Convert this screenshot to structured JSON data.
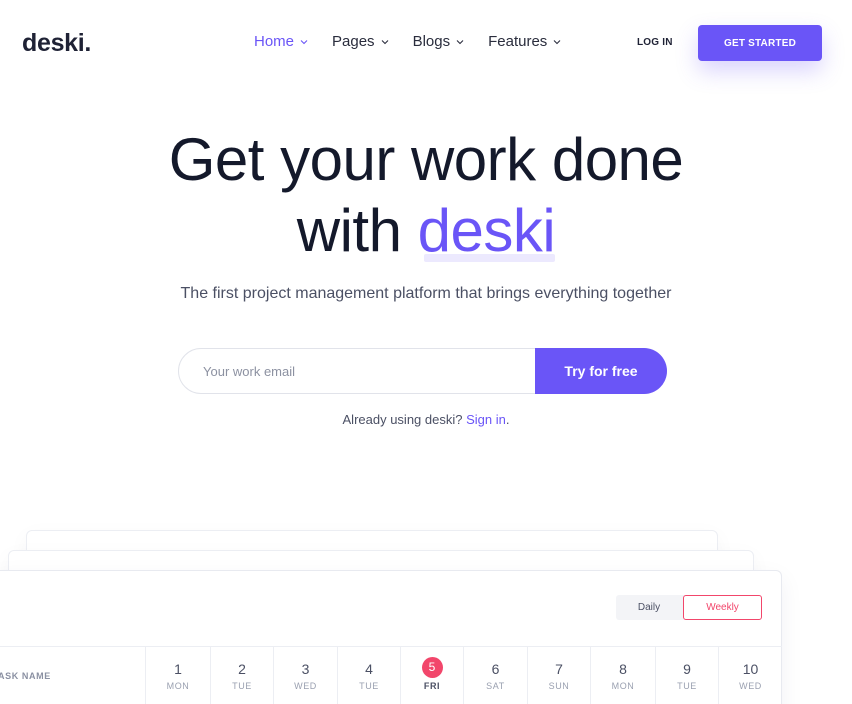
{
  "header": {
    "logo": "deski.",
    "nav": [
      {
        "label": "Home",
        "active": true,
        "icon": "chevron-down-icon"
      },
      {
        "label": "Pages",
        "active": false,
        "icon": "chevron-down-icon"
      },
      {
        "label": "Blogs",
        "active": false,
        "icon": "chevron-down-icon"
      },
      {
        "label": "Features",
        "active": false,
        "icon": "chevron-down-icon"
      }
    ],
    "login": "LOG IN",
    "cta": "GET STARTED"
  },
  "hero": {
    "title_line1": "Get your work done",
    "title_line2_prefix": "with",
    "title_accent": "deski",
    "subtitle": "The first project management platform that brings everything together",
    "email_placeholder": "Your work email",
    "email_value": "",
    "cta": "Try for free",
    "already_text": "Already using deski?",
    "sign_in": "Sign in",
    "period": "."
  },
  "schedule": {
    "toggle": {
      "daily": "Daily",
      "weekly": "Weekly",
      "selected": "Weekly"
    },
    "task_header": "ASK NAME",
    "days": [
      {
        "num": "1",
        "name": "MON"
      },
      {
        "num": "2",
        "name": "TUE"
      },
      {
        "num": "3",
        "name": "WED"
      },
      {
        "num": "4",
        "name": "TUE"
      },
      {
        "num": "5",
        "name": "FRI",
        "today": true
      },
      {
        "num": "6",
        "name": "SAT"
      },
      {
        "num": "7",
        "name": "SUN"
      },
      {
        "num": "8",
        "name": "MON"
      },
      {
        "num": "9",
        "name": "TUE"
      },
      {
        "num": "10",
        "name": "WED"
      }
    ]
  },
  "colors": {
    "accent": "#6a55f7",
    "highlight": "#f2466b",
    "text": "#14192b"
  }
}
